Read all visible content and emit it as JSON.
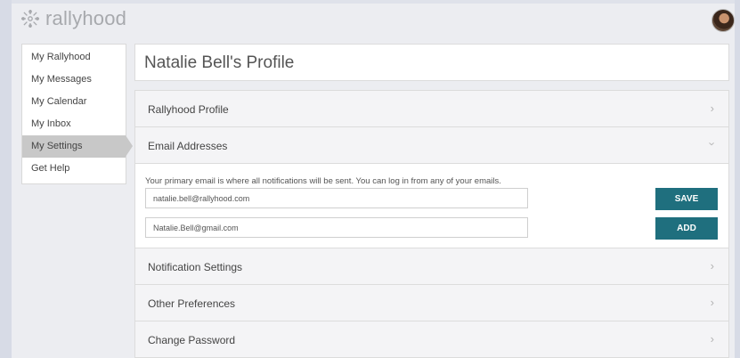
{
  "header": {
    "logo_text": "rallyhood"
  },
  "sidebar": {
    "items": [
      {
        "label": "My Rallyhood"
      },
      {
        "label": "My Messages"
      },
      {
        "label": "My Calendar"
      },
      {
        "label": "My Inbox"
      },
      {
        "label": "My Settings",
        "active": true
      },
      {
        "label": "Get Help"
      }
    ]
  },
  "main": {
    "title": "Natalie Bell's Profile",
    "sections": [
      {
        "label": "Rallyhood Profile",
        "chevron": "chevron-right-icon"
      },
      {
        "label": "Email Addresses",
        "chevron": "chevron-down-icon"
      },
      {
        "label": "Notification Settings",
        "chevron": "chevron-right-icon"
      },
      {
        "label": "Other Preferences",
        "chevron": "chevron-right-icon"
      },
      {
        "label": "Change Password",
        "chevron": "chevron-right-icon"
      }
    ],
    "email_panel": {
      "description": "Your primary email is where all notifications will be sent. You can log in from any of your emails.",
      "primary_email": "natalie.bell@rallyhood.com",
      "secondary_email": "Natalie.Bell@gmail.com",
      "save_label": "SAVE",
      "add_label": "ADD"
    }
  },
  "colors": {
    "button": "#1f6f7e",
    "active_sidebar": "#c8c8c8",
    "background": "#ecedf1"
  }
}
